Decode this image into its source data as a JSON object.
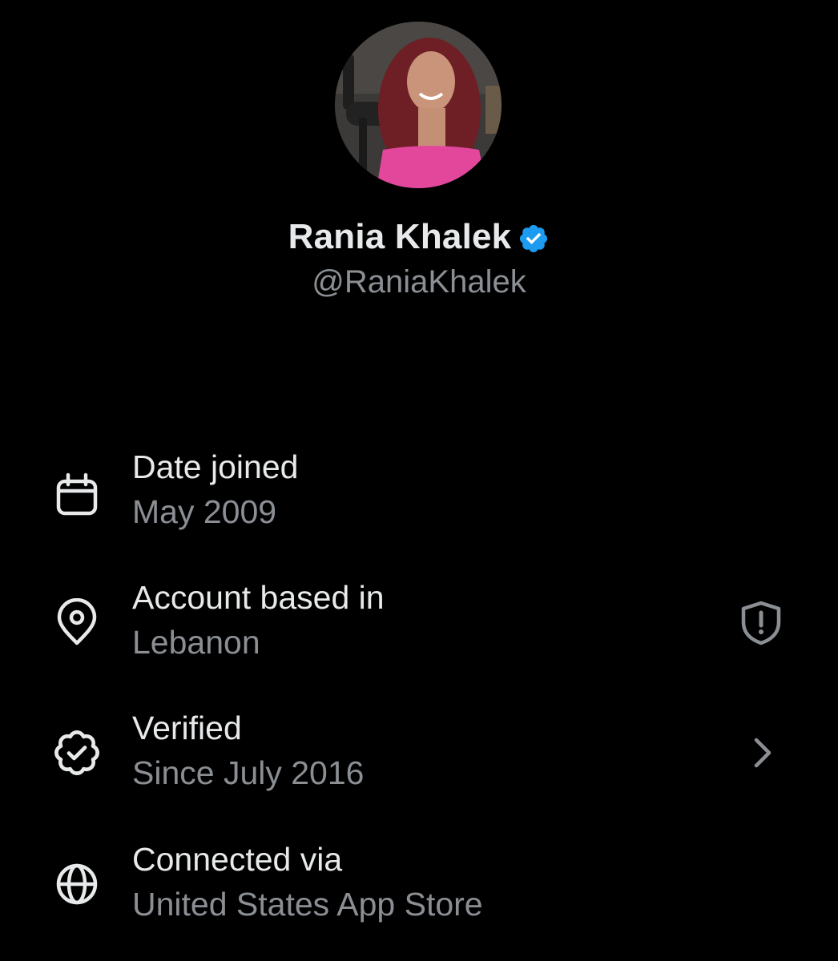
{
  "profile": {
    "display_name": "Rania Khalek",
    "handle": "@RaniaKhalek",
    "verified_badge_color": "#1d9bf0",
    "avatar_icon": "profile-photo"
  },
  "about": {
    "items": [
      {
        "title": "Date joined",
        "value": "May 2009",
        "icon": "calendar-icon"
      },
      {
        "title": "Account based in",
        "value": "Lebanon",
        "icon": "location-pin-icon",
        "trailing_icon": "shield-alert-icon"
      },
      {
        "title": "Verified",
        "value": "Since July 2016",
        "icon": "verified-check-icon",
        "trailing_icon": "chevron-right-icon"
      },
      {
        "title": "Connected via",
        "value": "United States App Store",
        "icon": "globe-icon"
      }
    ]
  },
  "colors": {
    "background": "#000000",
    "primary_text": "#e7e9ea",
    "secondary_text": "#8b8f94",
    "accent": "#1d9bf0"
  }
}
